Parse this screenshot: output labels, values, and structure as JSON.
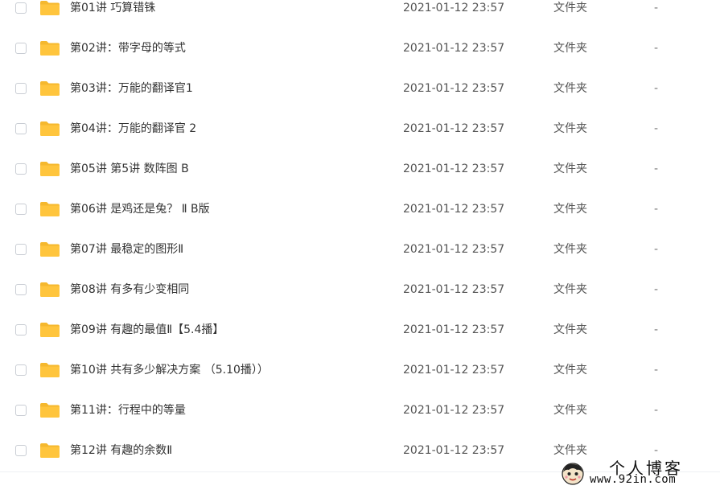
{
  "files": [
    {
      "name": "第01讲 巧算错铢",
      "date": "2021-01-12 23:57",
      "type": "文件夹",
      "size": "-"
    },
    {
      "name": "第02讲：带字母的等式",
      "date": "2021-01-12 23:57",
      "type": "文件夹",
      "size": "-"
    },
    {
      "name": "第03讲：万能的翻译官1",
      "date": "2021-01-12 23:57",
      "type": "文件夹",
      "size": "-"
    },
    {
      "name": "第04讲：万能的翻译官 2",
      "date": "2021-01-12 23:57",
      "type": "文件夹",
      "size": "-"
    },
    {
      "name": "第05讲 第5讲 数阵图 B",
      "date": "2021-01-12 23:57",
      "type": "文件夹",
      "size": "-"
    },
    {
      "name": "第06讲 是鸡还是兔？ Ⅱ B版",
      "date": "2021-01-12 23:57",
      "type": "文件夹",
      "size": "-"
    },
    {
      "name": "第07讲 最稳定的图形Ⅱ",
      "date": "2021-01-12 23:57",
      "type": "文件夹",
      "size": "-"
    },
    {
      "name": "第08讲 有多有少变相同",
      "date": "2021-01-12 23:57",
      "type": "文件夹",
      "size": "-"
    },
    {
      "name": "第09讲 有趣的最值Ⅱ【5.4播】",
      "date": "2021-01-12 23:57",
      "type": "文件夹",
      "size": "-"
    },
    {
      "name": "第10讲 共有多少解决方案 （5.10播））",
      "date": "2021-01-12 23:57",
      "type": "文件夹",
      "size": "-"
    },
    {
      "name": "第11讲：行程中的等量",
      "date": "2021-01-12 23:57",
      "type": "文件夹",
      "size": "-"
    },
    {
      "name": "第12讲 有趣的余数Ⅱ",
      "date": "2021-01-12 23:57",
      "type": "文件夹",
      "size": "-"
    }
  ],
  "watermark": {
    "title": "个人博客",
    "url": "www.92in.com"
  },
  "colors": {
    "folder": "#FFC53D",
    "folder_tab": "#F5B82E",
    "text": "#333333",
    "muted": "#555555"
  },
  "icons": {
    "folder": "folder-icon",
    "checkbox": "checkbox-icon",
    "avatar": "avatar-icon"
  }
}
